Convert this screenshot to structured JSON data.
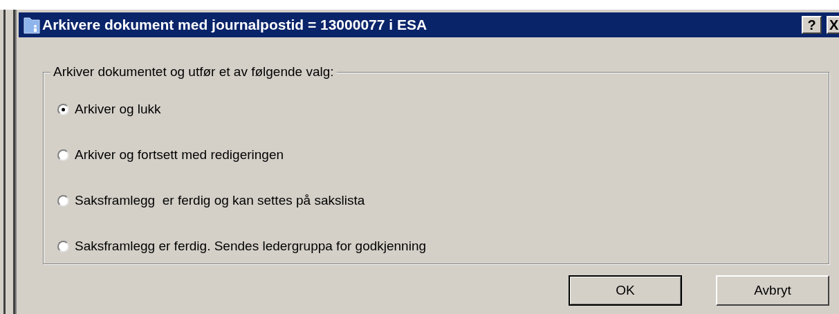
{
  "window": {
    "title": "Arkivere dokument med journalpostid = 13000077 i ESA",
    "help_button": "?",
    "close_button": "X"
  },
  "group": {
    "legend": "Arkiver dokumentet og utfør et av følgende valg:",
    "options": [
      {
        "label": "Arkiver og lukk",
        "selected": true
      },
      {
        "label": "Arkiver og fortsett med redigeringen",
        "selected": false
      },
      {
        "label": "Saksframlegg  er ferdig og kan settes på sakslista",
        "selected": false
      },
      {
        "label": "Saksframlegg er ferdig. Sendes ledergruppa for godkjenning",
        "selected": false
      }
    ]
  },
  "buttons": [
    {
      "label": "OK",
      "default": true
    },
    {
      "label": "Avbryt",
      "default": false
    }
  ]
}
